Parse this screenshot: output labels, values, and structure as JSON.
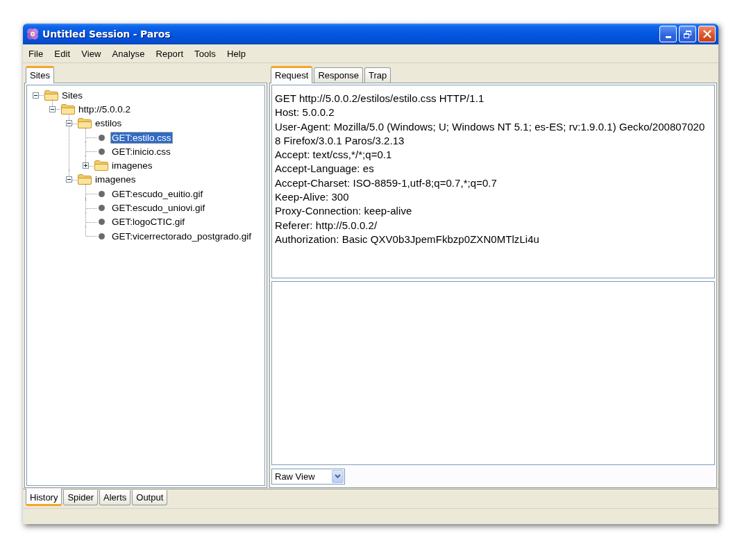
{
  "window": {
    "title": "Untitled Session - Paros"
  },
  "menu_bar": [
    "File",
    "Edit",
    "View",
    "Analyse",
    "Report",
    "Tools",
    "Help"
  ],
  "sites_panel": {
    "tabs": [
      {
        "label": "Sites",
        "selected": true
      }
    ],
    "tree": [
      {
        "label": "Sites",
        "kind": "folder",
        "expanded": true,
        "selected": false,
        "children": [
          {
            "label": "http://5.0.0.2",
            "kind": "folder",
            "expanded": true,
            "selected": false,
            "children": [
              {
                "label": "estilos",
                "kind": "folder",
                "expanded": true,
                "selected": false,
                "children": [
                  {
                    "label": "GET:estilo.css",
                    "kind": "request",
                    "selected": true
                  },
                  {
                    "label": "GET:inicio.css",
                    "kind": "request",
                    "selected": false
                  },
                  {
                    "label": "imagenes",
                    "kind": "folder",
                    "expanded": false,
                    "selected": false
                  }
                ]
              },
              {
                "label": "imagenes",
                "kind": "folder",
                "expanded": true,
                "selected": false,
                "children": [
                  {
                    "label": "GET:escudo_euitio.gif",
                    "kind": "request",
                    "selected": false
                  },
                  {
                    "label": "GET:escudo_uniovi.gif",
                    "kind": "request",
                    "selected": false
                  },
                  {
                    "label": "GET:logoCTIC.gif",
                    "kind": "request",
                    "selected": false
                  },
                  {
                    "label": "GET:vicerrectorado_postgrado.gif",
                    "kind": "request",
                    "selected": false
                  }
                ]
              }
            ]
          }
        ]
      }
    ]
  },
  "request_panel": {
    "tabs": [
      {
        "label": "Request",
        "selected": true
      },
      {
        "label": "Response",
        "selected": false
      },
      {
        "label": "Trap",
        "selected": false
      }
    ],
    "request_text": [
      "GET http://5.0.0.2/estilos/estilo.css HTTP/1.1",
      "Host: 5.0.0.2",
      "User-Agent: Mozilla/5.0 (Windows; U; Windows NT 5.1; es-ES; rv:1.9.0.1) Gecko/200807020",
      "8 Firefox/3.0.1 Paros/3.2.13",
      "Accept: text/css,*/*;q=0.1",
      "Accept-Language: es",
      "Accept-Charset: ISO-8859-1,utf-8;q=0.7,*;q=0.7",
      "Keep-Alive: 300",
      "Proxy-Connection: keep-alive",
      "Referer: http://5.0.0.2/",
      "Authorization: Basic QXV0b3JpemFkbzp0ZXN0MTlzLi4u"
    ],
    "view_mode": {
      "value": "Raw View"
    }
  },
  "bottom_tabs": [
    {
      "label": "History",
      "selected": true
    },
    {
      "label": "Spider",
      "selected": false
    },
    {
      "label": "Alerts",
      "selected": false
    },
    {
      "label": "Output",
      "selected": false
    }
  ]
}
